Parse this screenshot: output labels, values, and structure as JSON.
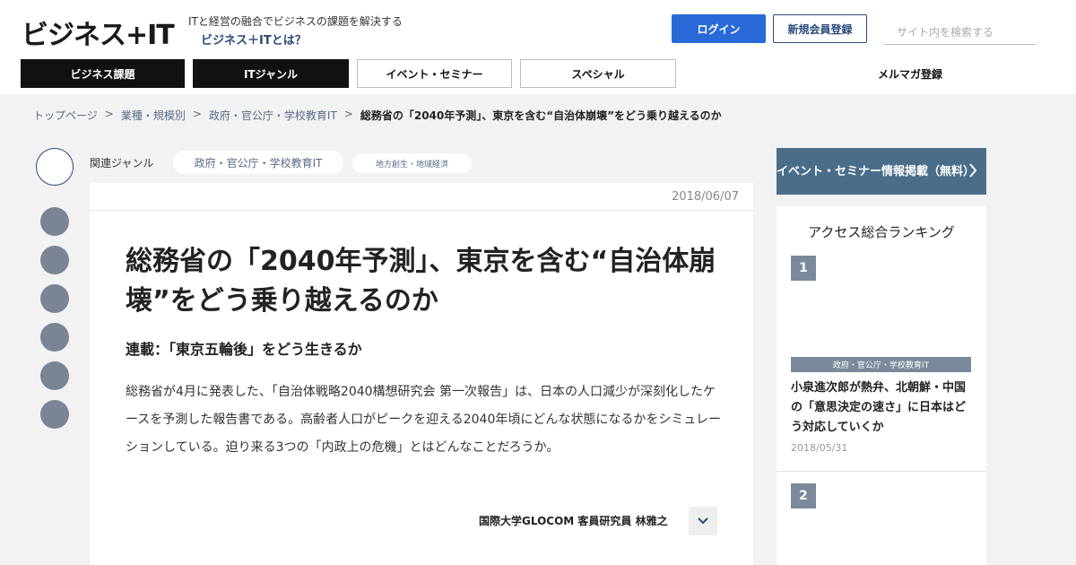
{
  "header": {
    "logo": "ビジネス+IT",
    "tagline": "ITと経営の融合でビジネスの課題を解決する",
    "about_link": "ビジネス＋ITとは？",
    "login_label": "ログイン",
    "register_label": "新規会員登録",
    "search_placeholder": "サイト内を検索する"
  },
  "nav": {
    "items": [
      {
        "label": "ビジネス課題"
      },
      {
        "label": "ITジャンル"
      },
      {
        "label": "イベント・セミナー"
      },
      {
        "label": "スペシャル"
      }
    ],
    "mailmag": "メルマガ登録"
  },
  "breadcrumb": {
    "items": [
      "トップページ",
      "業種・規模別",
      "政府・官公庁・学校教育IT"
    ],
    "separator": ">",
    "current": "総務省の「2040年予測」、東京を含む“自治体崩壊”をどう乗り越えるのか"
  },
  "genre": {
    "label": "関連ジャンル",
    "tags": [
      "政府・官公庁・学校教育IT",
      "地方創生・地域経済"
    ]
  },
  "article": {
    "date": "2018/06/07",
    "title": "総務省の「2040年予測」、東京を含む“自治体崩壊”をどう乗り越えるのか",
    "series": "連載：「東京五輪後」をどう生きるか",
    "lead": "総務省が4月に発表した、「自治体戦略2040構想研究会 第一次報告」は、日本の人口減少が深刻化したケースを予測した報告書である。高齢者人口がピークを迎える2040年頃にどんな状態になるかをシミュレーションしている。迫り来る3つの「内政上の危機」とはどんなことだろうか。",
    "author": "国際大学GLOCOM 客員研究員 林雅之"
  },
  "sidebar": {
    "event_banner": "イベント・セミナー情報掲載（無料）",
    "ranking": {
      "title": "アクセス総合ランキング",
      "items": [
        {
          "rank": "1",
          "category": "政府・官公庁・学校教育IT",
          "title": "小泉進次郎が熱弁、北朝鮮・中国の「意思決定の速さ」に日本はどう対応していくか",
          "date": "2018/05/31"
        },
        {
          "rank": "2"
        }
      ]
    }
  },
  "colors": {
    "primary_blue": "#2a6ad8",
    "navy": "#2a4a7a",
    "slate": "#7a8a9a",
    "banner": "#4a6e8a"
  }
}
